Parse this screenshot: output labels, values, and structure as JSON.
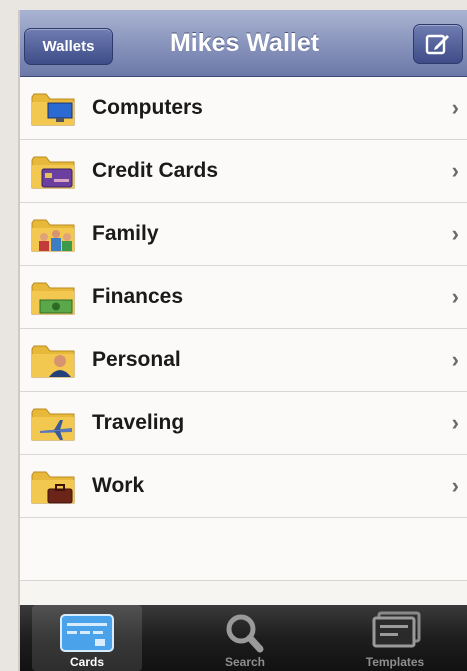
{
  "navbar": {
    "title": "Mikes Wallet",
    "back_label": "Wallets",
    "compose_icon": "compose-icon"
  },
  "categories": [
    {
      "label": "Computers",
      "icon": "computer-folder-icon"
    },
    {
      "label": "Credit Cards",
      "icon": "credit-card-folder-icon"
    },
    {
      "label": "Family",
      "icon": "family-folder-icon"
    },
    {
      "label": "Finances",
      "icon": "money-folder-icon"
    },
    {
      "label": "Personal",
      "icon": "person-folder-icon"
    },
    {
      "label": "Traveling",
      "icon": "airplane-folder-icon"
    },
    {
      "label": "Work",
      "icon": "briefcase-folder-icon"
    }
  ],
  "tabbar": {
    "tabs": [
      {
        "label": "Cards",
        "icon": "card-icon",
        "active": true
      },
      {
        "label": "Search",
        "icon": "search-icon",
        "active": false
      },
      {
        "label": "Templates",
        "icon": "templates-icon",
        "active": false
      }
    ]
  },
  "colors": {
    "navbar": "#8d98bf",
    "button": "#3e4c88",
    "tabbar": "#1e1e1e",
    "folder": "#e8b83a"
  }
}
